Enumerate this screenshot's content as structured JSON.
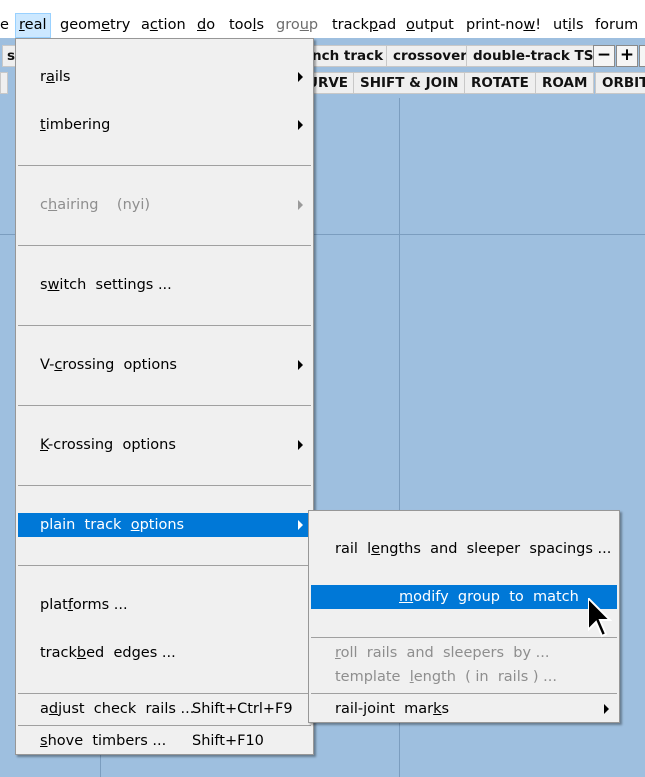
{
  "menubar": {
    "items": [
      {
        "label": "e",
        "state": "normal"
      },
      {
        "label": "real",
        "state": "active"
      },
      {
        "label": "geometry",
        "state": "normal"
      },
      {
        "label": "action",
        "state": "normal"
      },
      {
        "label": "do",
        "state": "normal"
      },
      {
        "label": "tools",
        "state": "normal"
      },
      {
        "label": "group",
        "state": "disabled"
      },
      {
        "label": "trackpad",
        "state": "normal"
      },
      {
        "label": "output",
        "state": "normal"
      },
      {
        "label": "print-now!",
        "state": "normal"
      },
      {
        "label": "utils",
        "state": "normal"
      },
      {
        "label": "forum",
        "state": "normal"
      }
    ]
  },
  "toolbar": {
    "row1": {
      "left_partial": "s",
      "buttons": [
        "nch track",
        "crossover",
        "double-track TS"
      ],
      "zoom_out": "−",
      "zoom_in": "+"
    },
    "row2": {
      "buttons": [
        "URVE",
        "SHIFT & JOIN",
        "ROTATE",
        "ROAM",
        "ORBIT"
      ]
    }
  },
  "menu_real": {
    "items": {
      "rails": "rails",
      "timbering": "timbering",
      "chairing": "chairing    (nyi)",
      "switch_settings": "switch  settings ...",
      "v_crossing": "V-crossing  options",
      "k_crossing": "K-crossing  options",
      "plain_track": "plain  track  options",
      "platforms": "platforms ...",
      "trackbed": "trackbed  edges ...",
      "adjust_check_rails": "adjust  check  rails ...",
      "adjust_check_rails_shortcut": "Shift+Ctrl+F9",
      "shove_timbers": "shove  timbers ...",
      "shove_timbers_shortcut": "Shift+F10"
    }
  },
  "menu_plain_track": {
    "items": {
      "rail_lengths": "rail  lengths  and  sleeper  spacings ...",
      "modify_group": "modify  group  to  match",
      "roll_rails": "roll  rails  and  sleepers  by ...",
      "template_length": "template  length  ( in  rails ) ...",
      "rail_joint_marks": "rail-joint  marks"
    }
  },
  "colors": {
    "canvas": "#9ebfdf",
    "highlight": "#0078d7",
    "menu_bg": "#f0f0f0"
  }
}
